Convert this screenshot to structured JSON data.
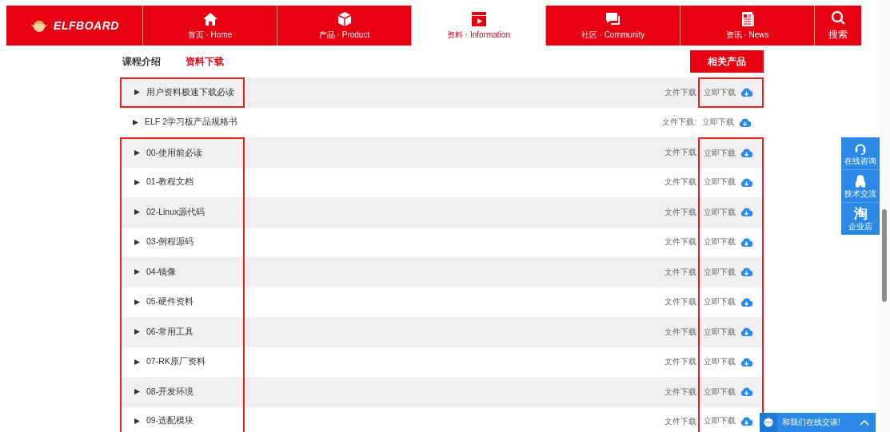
{
  "nav": {
    "logo": "ELFBOARD",
    "items": [
      {
        "label": "首页 · Home",
        "selected": false
      },
      {
        "label": "产品 · Product",
        "selected": false
      },
      {
        "label": "资料 · Information",
        "selected": true
      },
      {
        "label": "社区 · Community",
        "selected": false
      },
      {
        "label": "资讯 · News",
        "selected": false
      },
      {
        "label": "搜索",
        "selected": false
      }
    ]
  },
  "tabs": [
    {
      "label": "课程介绍",
      "selected": false
    },
    {
      "label": "资料下载",
      "selected": true
    }
  ],
  "related_button": "相关产品",
  "rows": [
    {
      "title": "用户资料极速下载必读",
      "file_label": "文件下载",
      "download_label": "立即下载",
      "highlighted": true
    },
    {
      "title": "ELF 2学习板产品规格书",
      "file_label": "文件下载:",
      "download_label": "立即下载",
      "highlighted": false
    },
    {
      "title": "00-使用前必读",
      "file_label": "文件下载",
      "download_label": "立即下载",
      "highlighted": true
    },
    {
      "title": "01-教程文档",
      "file_label": "文件下载",
      "download_label": "立即下载",
      "highlighted": true
    },
    {
      "title": "02-Linux源代码",
      "file_label": "文件下载",
      "download_label": "立即下载",
      "highlighted": true
    },
    {
      "title": "03-例程源码",
      "file_label": "文件下载",
      "download_label": "立即下载",
      "highlighted": true
    },
    {
      "title": "04-镜像",
      "file_label": "文件下载",
      "download_label": "立即下载",
      "highlighted": true
    },
    {
      "title": "05-硬件资料",
      "file_label": "文件下载",
      "download_label": "立即下载",
      "highlighted": true
    },
    {
      "title": "06-常用工具",
      "file_label": "文件下载",
      "download_label": "立即下载",
      "highlighted": true
    },
    {
      "title": "07-RK原厂资料",
      "file_label": "文件下载",
      "download_label": "立即下载",
      "highlighted": true
    },
    {
      "title": "08-开发环境",
      "file_label": "文件下载",
      "download_label": "立即下载",
      "highlighted": true
    },
    {
      "title": "09-选配模块",
      "file_label": "文件下载",
      "download_label": "立即下载",
      "highlighted": true
    }
  ],
  "side_panel": [
    {
      "label": "在线咨询"
    },
    {
      "label": "技术交流"
    },
    {
      "glyph": "淘",
      "label": "企业店"
    }
  ],
  "chat_bar": {
    "label": "和我们在线交谈!"
  }
}
